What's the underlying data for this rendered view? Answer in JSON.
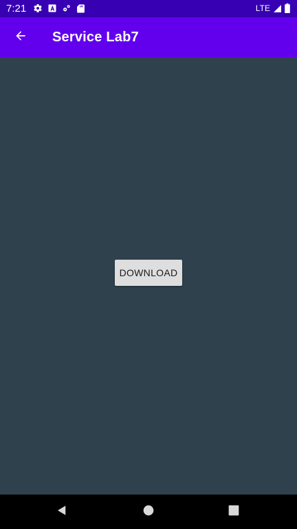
{
  "status_bar": {
    "time": "7:21",
    "network": "LTE",
    "left_icons": [
      "settings-icon",
      "font-icon",
      "sync-icon",
      "sd-card-icon"
    ],
    "right_icons": [
      "signal-icon",
      "battery-icon"
    ]
  },
  "app_bar": {
    "title": "Service Lab7",
    "back_icon": "arrow-back-icon"
  },
  "main": {
    "download_label": "DOWNLOAD"
  },
  "nav_bar": {
    "icons": [
      "back-triangle-icon",
      "home-circle-icon",
      "recents-square-icon"
    ]
  },
  "colors": {
    "status_bar": "#3700b3",
    "app_bar": "#6200ee",
    "background": "#2e414d",
    "button": "#dedede",
    "nav_bar": "#000000"
  }
}
